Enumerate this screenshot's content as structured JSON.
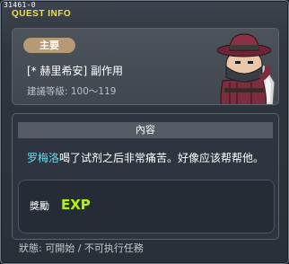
{
  "window": {
    "quest_id": "31461-0",
    "title": "QUEST INFO"
  },
  "header": {
    "badge": "主要",
    "quest_name": "[* 赫里希安] 副作用",
    "level_requirement": "建議等級: 100～119",
    "npc_portrait_icon": "npc-portrait-icon"
  },
  "content": {
    "section_title": "內容",
    "npc_name": "罗梅洛",
    "description": "喝了试剂之后非常痛苦。好像应该帮帮他。"
  },
  "reward": {
    "label": "獎勵",
    "exp_text": "EXP",
    "exp_icon": "exp-icon"
  },
  "status": {
    "text": "狀態: 可開始 / 不可执行任務"
  },
  "colors": {
    "title": "#ece04f",
    "badge": "#b69a73",
    "npc_link": "#69dcf0",
    "exp_fill": "#b2ee20"
  }
}
